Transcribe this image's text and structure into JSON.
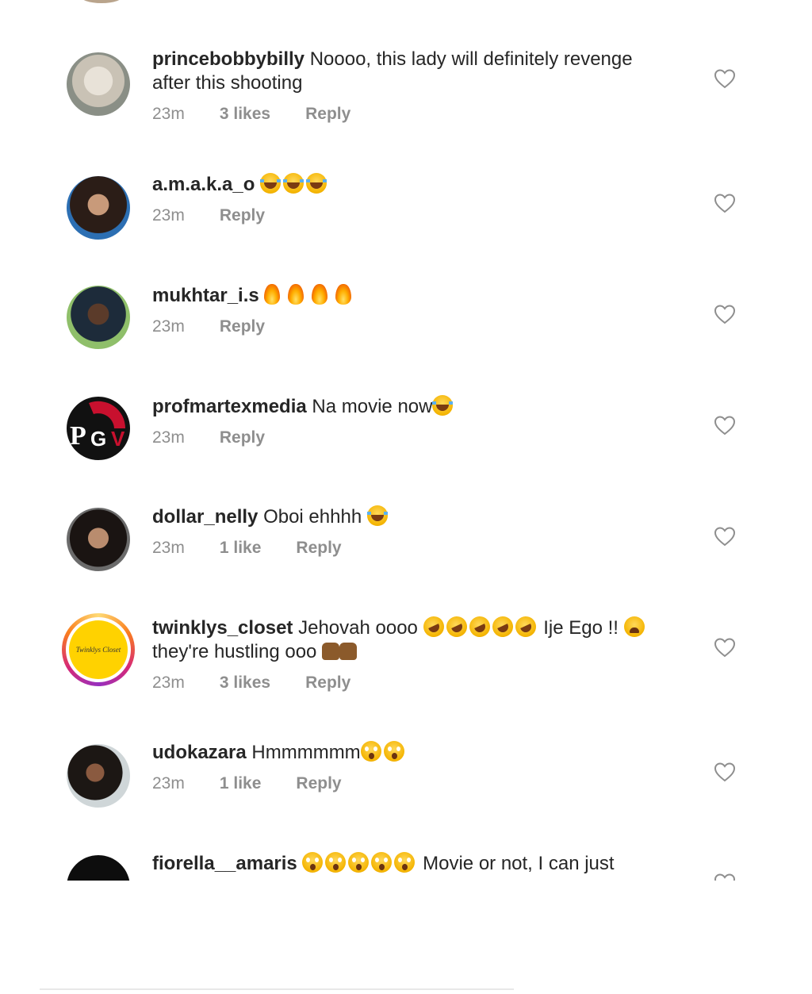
{
  "comments": [
    {
      "username": "princebobbybilly",
      "text_line1": "Noooo, this lady will definitely revenge",
      "text_line2": "after this shooting",
      "time": "23m",
      "likes": "3 likes",
      "reply": "Reply"
    },
    {
      "username": "a.m.a.k.a_o",
      "text": "",
      "emoji": [
        "laugh",
        "laugh",
        "laugh"
      ],
      "time": "23m",
      "likes": "",
      "reply": "Reply"
    },
    {
      "username": "mukhtar_i.s",
      "text": "",
      "emoji": [
        "fire",
        "fire",
        "fire",
        "fire"
      ],
      "time": "23m",
      "likes": "",
      "reply": "Reply"
    },
    {
      "username": "profmartexmedia",
      "text": "Na movie now",
      "emoji": [
        "laugh"
      ],
      "time": "23m",
      "likes": "",
      "reply": "Reply"
    },
    {
      "username": "dollar_nelly",
      "text": "Oboi ehhhh",
      "emoji": [
        "laugh"
      ],
      "time": "23m",
      "likes": "1 like",
      "reply": "Reply"
    },
    {
      "username": "twinklys_closet",
      "text_a": "Jehovah oooo",
      "text_b": "Ije Ego !!",
      "text_line2": "they're hustling ooo",
      "time": "23m",
      "likes": "3 likes",
      "reply": "Reply",
      "avatar_text": "Twinklys Closet"
    },
    {
      "username": "udokazara",
      "text": "Hmmmmmm",
      "emoji": [
        "shock",
        "shock"
      ],
      "time": "23m",
      "likes": "1 like",
      "reply": "Reply"
    },
    {
      "username": "fiorella__amaris",
      "text": "Movie or not, I can just",
      "emoji": [
        "shock",
        "shock",
        "shock",
        "shock",
        "shock"
      ]
    }
  ],
  "icons": {
    "like": "heart-outline-icon"
  },
  "colors": {
    "text": "#262626",
    "muted": "#8e8e8e",
    "ring": "#d6249f"
  }
}
